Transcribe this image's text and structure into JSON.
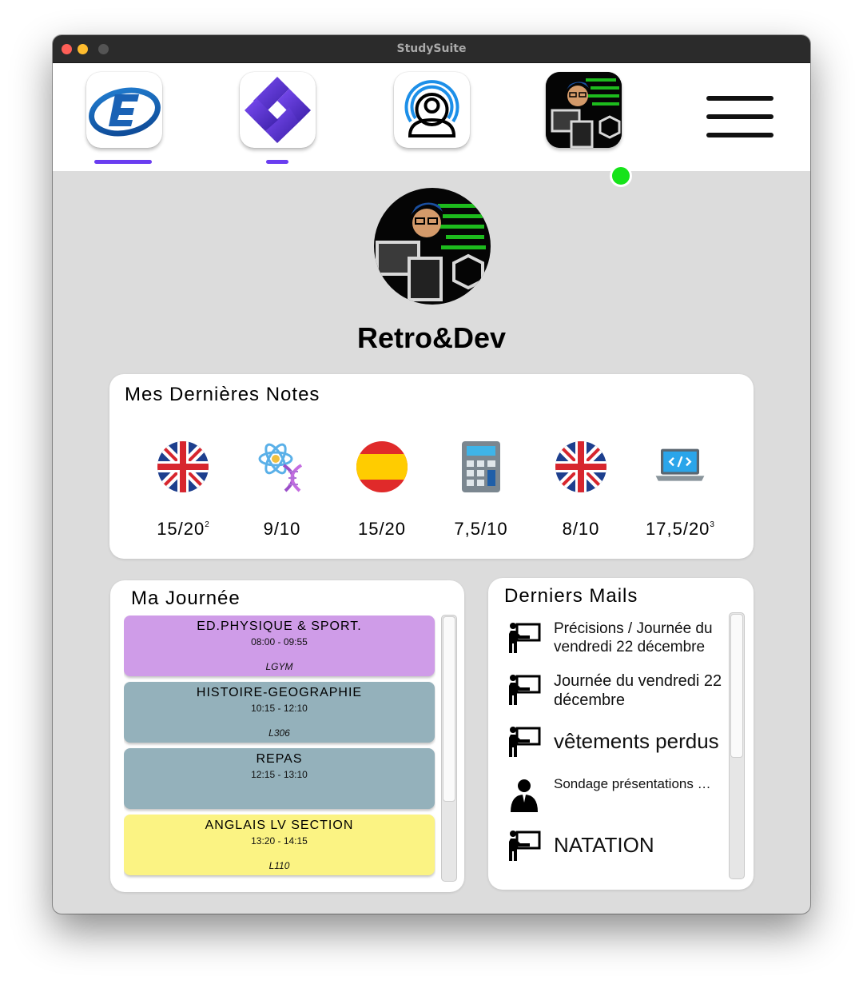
{
  "window": {
    "title": "StudySuite"
  },
  "nav": {
    "apps": [
      {
        "name": "ecoledirecte",
        "icon": "ecoledirecte-e-icon",
        "active": true
      },
      {
        "name": "purple-app",
        "icon": "purple-diamond-icon",
        "active": true
      },
      {
        "name": "profile-app",
        "icon": "broadcast-person-icon",
        "active": false
      },
      {
        "name": "user",
        "icon": "user-avatar",
        "status": "online",
        "status_color": "#16e31a"
      }
    ],
    "menu_icon": "hamburger-menu-icon",
    "accent": "#6a3df0"
  },
  "profile": {
    "name": "Retro&Dev"
  },
  "grades": {
    "title": "Mes Dernières Notes",
    "items": [
      {
        "icon": "uk-flag-icon",
        "value": "15/20",
        "sup": "2"
      },
      {
        "icon": "atom-dna-icon",
        "value": "9/10",
        "sup": ""
      },
      {
        "icon": "spain-flag-icon",
        "value": "15/20",
        "sup": ""
      },
      {
        "icon": "calculator-icon",
        "value": "7,5/10",
        "sup": ""
      },
      {
        "icon": "uk-flag-icon",
        "value": "8/10",
        "sup": ""
      },
      {
        "icon": "laptop-code-icon",
        "value": "17,5/20",
        "sup": "3"
      }
    ]
  },
  "schedule": {
    "title": "Ma Journée",
    "lessons": [
      {
        "name": "ED.PHYSIQUE & SPORT.",
        "time": "08:00 - 09:55",
        "room": "LGYM",
        "color": "#cf9ce8"
      },
      {
        "name": "HISTOIRE-GEOGRAPHIE",
        "time": "10:15 - 12:10",
        "room": "L306",
        "color": "#94b1bb"
      },
      {
        "name": "REPAS",
        "time": "12:15 - 13:10",
        "room": "",
        "color": "#94b1bb"
      },
      {
        "name": "ANGLAIS LV SECTION",
        "time": "13:20 - 14:15",
        "room": "L110",
        "color": "#fbf383"
      }
    ]
  },
  "mails": {
    "title": "Derniers Mails",
    "items": [
      {
        "icon": "teacher-board-icon",
        "subject": "Précisions / Journée du vendredi 22 décembre"
      },
      {
        "icon": "teacher-board-icon",
        "subject": "Journée du vendredi 22 décembre"
      },
      {
        "icon": "teacher-board-icon",
        "subject": "vêtements perdus"
      },
      {
        "icon": "person-icon",
        "subject": "Sondage présentations formations anciens él…"
      },
      {
        "icon": "teacher-board-icon",
        "subject": "NATATION"
      }
    ]
  }
}
